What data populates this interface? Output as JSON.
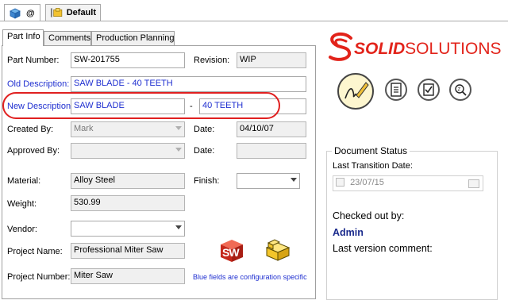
{
  "top_tabs": [
    {
      "label": "@"
    },
    {
      "label": "Default"
    }
  ],
  "logo": {
    "text_bold": "SOLID",
    "text_light": "SOLUTIONS",
    "color": "#e2231a"
  },
  "tabs": [
    "Part Info",
    "Comments",
    "Production Planning"
  ],
  "form": {
    "part_number_label": "Part Number:",
    "part_number": "SW-201755",
    "revision_label": "Revision:",
    "revision": "WIP",
    "old_desc_label": "Old Description:",
    "old_desc": "SAW BLADE - 40 TEETH",
    "new_desc_label": "New Description",
    "new_desc_1": "SAW BLADE",
    "new_desc_sep": "-",
    "new_desc_2": "40 TEETH",
    "created_by_label": "Created By:",
    "created_by": "Mark",
    "date_label": "Date:",
    "created_date": "04/10/07",
    "approved_by_label": "Approved By:",
    "approved_by": "",
    "approved_date_label": "Date:",
    "approved_date": "",
    "material_label": "Material:",
    "material": "Alloy Steel",
    "finish_label": "Finish:",
    "finish": "",
    "weight_label": "Weight:",
    "weight": "530.99",
    "vendor_label": "Vendor:",
    "vendor": "",
    "project_name_label": "Project Name:",
    "project_name": "Professional Miter Saw",
    "project_number_label": "Project Number:",
    "project_number": "Miter Saw",
    "footnote": "Blue fields are configuration specific",
    "sw_badge": "SW"
  },
  "doc_status": {
    "title": "Document Status",
    "last_transition_label": "Last Transition Date:",
    "last_transition_date": "23/07/15",
    "checked_out_label": "Checked out by:",
    "checked_out_user": "Admin",
    "last_version_comment_label": "Last version comment:"
  },
  "colors": {
    "blue_field_text": "#1f2fd0",
    "highlight_oval": "#e02020",
    "sw_red": "#d42a1c"
  }
}
